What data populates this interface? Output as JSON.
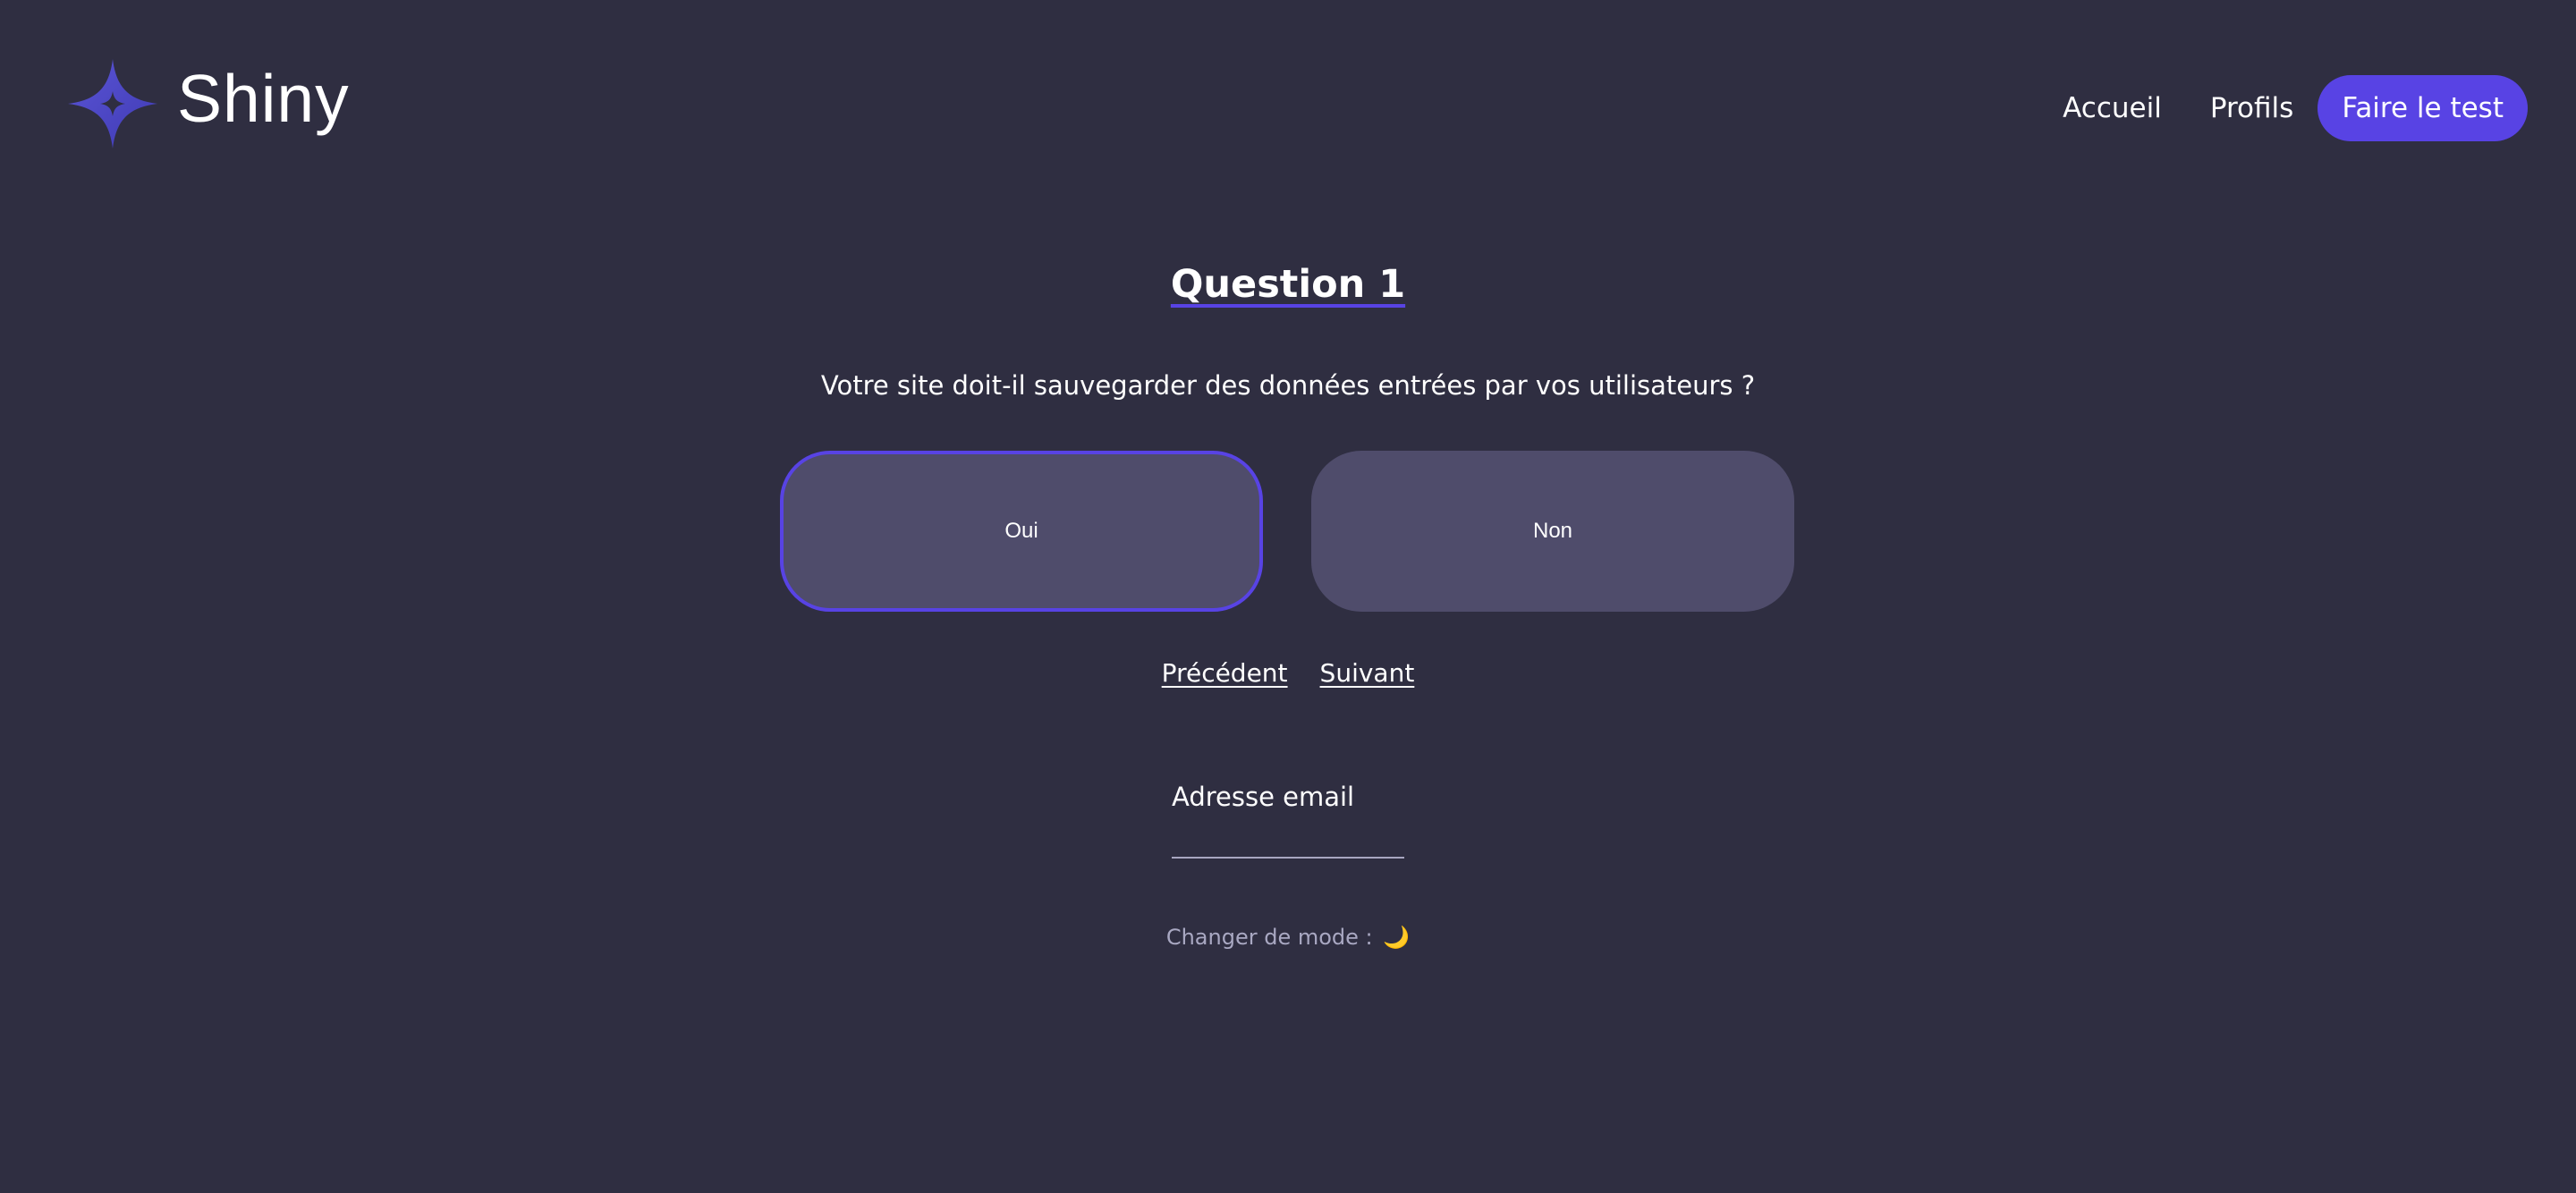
{
  "header": {
    "logo_text": "Shiny",
    "nav": {
      "accueil": "Accueil",
      "profils": "Profils",
      "cta": "Faire le test"
    }
  },
  "survey": {
    "title": "Question 1",
    "question": "Votre site doit-il sauvegarder des données entrées par vos utilisateurs ?",
    "answers": {
      "yes": "Oui",
      "no": "Non"
    },
    "selected_answer": "Oui",
    "previous": "Précédent",
    "next": "Suivant"
  },
  "email": {
    "label": "Adresse email",
    "value": ""
  },
  "theme": {
    "label": "Changer de mode :",
    "icon": "🌙",
    "icon_name": "moon-icon"
  },
  "colors": {
    "background": "#2f2e41",
    "accent": "#5843e4",
    "answer_background": "#4f4c6b",
    "secondary_text": "#a9a8c2"
  }
}
